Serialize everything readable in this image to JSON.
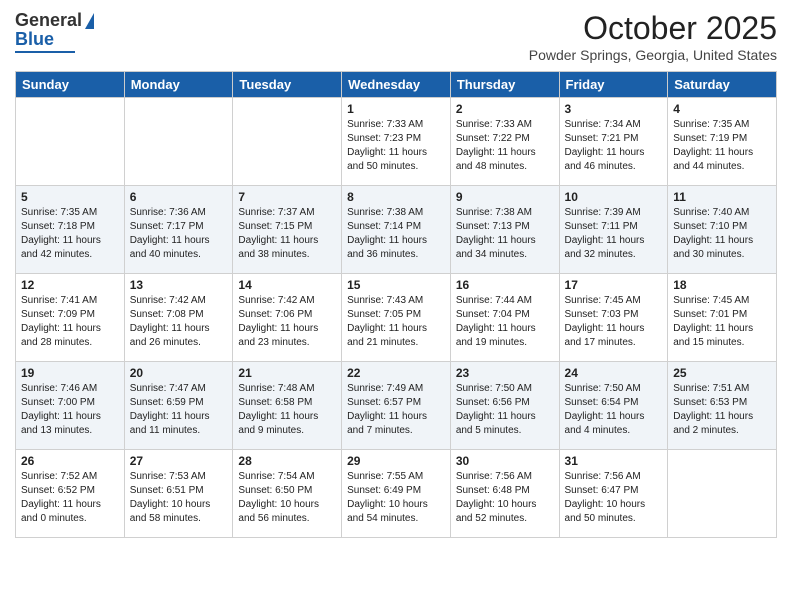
{
  "header": {
    "logo_general": "General",
    "logo_blue": "Blue",
    "month_title": "October 2025",
    "location": "Powder Springs, Georgia, United States"
  },
  "days_of_week": [
    "Sunday",
    "Monday",
    "Tuesday",
    "Wednesday",
    "Thursday",
    "Friday",
    "Saturday"
  ],
  "weeks": [
    [
      {
        "day": "",
        "sunrise": "",
        "sunset": "",
        "daylight": ""
      },
      {
        "day": "",
        "sunrise": "",
        "sunset": "",
        "daylight": ""
      },
      {
        "day": "",
        "sunrise": "",
        "sunset": "",
        "daylight": ""
      },
      {
        "day": "1",
        "sunrise": "Sunrise: 7:33 AM",
        "sunset": "Sunset: 7:23 PM",
        "daylight": "Daylight: 11 hours and 50 minutes."
      },
      {
        "day": "2",
        "sunrise": "Sunrise: 7:33 AM",
        "sunset": "Sunset: 7:22 PM",
        "daylight": "Daylight: 11 hours and 48 minutes."
      },
      {
        "day": "3",
        "sunrise": "Sunrise: 7:34 AM",
        "sunset": "Sunset: 7:21 PM",
        "daylight": "Daylight: 11 hours and 46 minutes."
      },
      {
        "day": "4",
        "sunrise": "Sunrise: 7:35 AM",
        "sunset": "Sunset: 7:19 PM",
        "daylight": "Daylight: 11 hours and 44 minutes."
      }
    ],
    [
      {
        "day": "5",
        "sunrise": "Sunrise: 7:35 AM",
        "sunset": "Sunset: 7:18 PM",
        "daylight": "Daylight: 11 hours and 42 minutes."
      },
      {
        "day": "6",
        "sunrise": "Sunrise: 7:36 AM",
        "sunset": "Sunset: 7:17 PM",
        "daylight": "Daylight: 11 hours and 40 minutes."
      },
      {
        "day": "7",
        "sunrise": "Sunrise: 7:37 AM",
        "sunset": "Sunset: 7:15 PM",
        "daylight": "Daylight: 11 hours and 38 minutes."
      },
      {
        "day": "8",
        "sunrise": "Sunrise: 7:38 AM",
        "sunset": "Sunset: 7:14 PM",
        "daylight": "Daylight: 11 hours and 36 minutes."
      },
      {
        "day": "9",
        "sunrise": "Sunrise: 7:38 AM",
        "sunset": "Sunset: 7:13 PM",
        "daylight": "Daylight: 11 hours and 34 minutes."
      },
      {
        "day": "10",
        "sunrise": "Sunrise: 7:39 AM",
        "sunset": "Sunset: 7:11 PM",
        "daylight": "Daylight: 11 hours and 32 minutes."
      },
      {
        "day": "11",
        "sunrise": "Sunrise: 7:40 AM",
        "sunset": "Sunset: 7:10 PM",
        "daylight": "Daylight: 11 hours and 30 minutes."
      }
    ],
    [
      {
        "day": "12",
        "sunrise": "Sunrise: 7:41 AM",
        "sunset": "Sunset: 7:09 PM",
        "daylight": "Daylight: 11 hours and 28 minutes."
      },
      {
        "day": "13",
        "sunrise": "Sunrise: 7:42 AM",
        "sunset": "Sunset: 7:08 PM",
        "daylight": "Daylight: 11 hours and 26 minutes."
      },
      {
        "day": "14",
        "sunrise": "Sunrise: 7:42 AM",
        "sunset": "Sunset: 7:06 PM",
        "daylight": "Daylight: 11 hours and 23 minutes."
      },
      {
        "day": "15",
        "sunrise": "Sunrise: 7:43 AM",
        "sunset": "Sunset: 7:05 PM",
        "daylight": "Daylight: 11 hours and 21 minutes."
      },
      {
        "day": "16",
        "sunrise": "Sunrise: 7:44 AM",
        "sunset": "Sunset: 7:04 PM",
        "daylight": "Daylight: 11 hours and 19 minutes."
      },
      {
        "day": "17",
        "sunrise": "Sunrise: 7:45 AM",
        "sunset": "Sunset: 7:03 PM",
        "daylight": "Daylight: 11 hours and 17 minutes."
      },
      {
        "day": "18",
        "sunrise": "Sunrise: 7:45 AM",
        "sunset": "Sunset: 7:01 PM",
        "daylight": "Daylight: 11 hours and 15 minutes."
      }
    ],
    [
      {
        "day": "19",
        "sunrise": "Sunrise: 7:46 AM",
        "sunset": "Sunset: 7:00 PM",
        "daylight": "Daylight: 11 hours and 13 minutes."
      },
      {
        "day": "20",
        "sunrise": "Sunrise: 7:47 AM",
        "sunset": "Sunset: 6:59 PM",
        "daylight": "Daylight: 11 hours and 11 minutes."
      },
      {
        "day": "21",
        "sunrise": "Sunrise: 7:48 AM",
        "sunset": "Sunset: 6:58 PM",
        "daylight": "Daylight: 11 hours and 9 minutes."
      },
      {
        "day": "22",
        "sunrise": "Sunrise: 7:49 AM",
        "sunset": "Sunset: 6:57 PM",
        "daylight": "Daylight: 11 hours and 7 minutes."
      },
      {
        "day": "23",
        "sunrise": "Sunrise: 7:50 AM",
        "sunset": "Sunset: 6:56 PM",
        "daylight": "Daylight: 11 hours and 5 minutes."
      },
      {
        "day": "24",
        "sunrise": "Sunrise: 7:50 AM",
        "sunset": "Sunset: 6:54 PM",
        "daylight": "Daylight: 11 hours and 4 minutes."
      },
      {
        "day": "25",
        "sunrise": "Sunrise: 7:51 AM",
        "sunset": "Sunset: 6:53 PM",
        "daylight": "Daylight: 11 hours and 2 minutes."
      }
    ],
    [
      {
        "day": "26",
        "sunrise": "Sunrise: 7:52 AM",
        "sunset": "Sunset: 6:52 PM",
        "daylight": "Daylight: 11 hours and 0 minutes."
      },
      {
        "day": "27",
        "sunrise": "Sunrise: 7:53 AM",
        "sunset": "Sunset: 6:51 PM",
        "daylight": "Daylight: 10 hours and 58 minutes."
      },
      {
        "day": "28",
        "sunrise": "Sunrise: 7:54 AM",
        "sunset": "Sunset: 6:50 PM",
        "daylight": "Daylight: 10 hours and 56 minutes."
      },
      {
        "day": "29",
        "sunrise": "Sunrise: 7:55 AM",
        "sunset": "Sunset: 6:49 PM",
        "daylight": "Daylight: 10 hours and 54 minutes."
      },
      {
        "day": "30",
        "sunrise": "Sunrise: 7:56 AM",
        "sunset": "Sunset: 6:48 PM",
        "daylight": "Daylight: 10 hours and 52 minutes."
      },
      {
        "day": "31",
        "sunrise": "Sunrise: 7:56 AM",
        "sunset": "Sunset: 6:47 PM",
        "daylight": "Daylight: 10 hours and 50 minutes."
      },
      {
        "day": "",
        "sunrise": "",
        "sunset": "",
        "daylight": ""
      }
    ]
  ]
}
